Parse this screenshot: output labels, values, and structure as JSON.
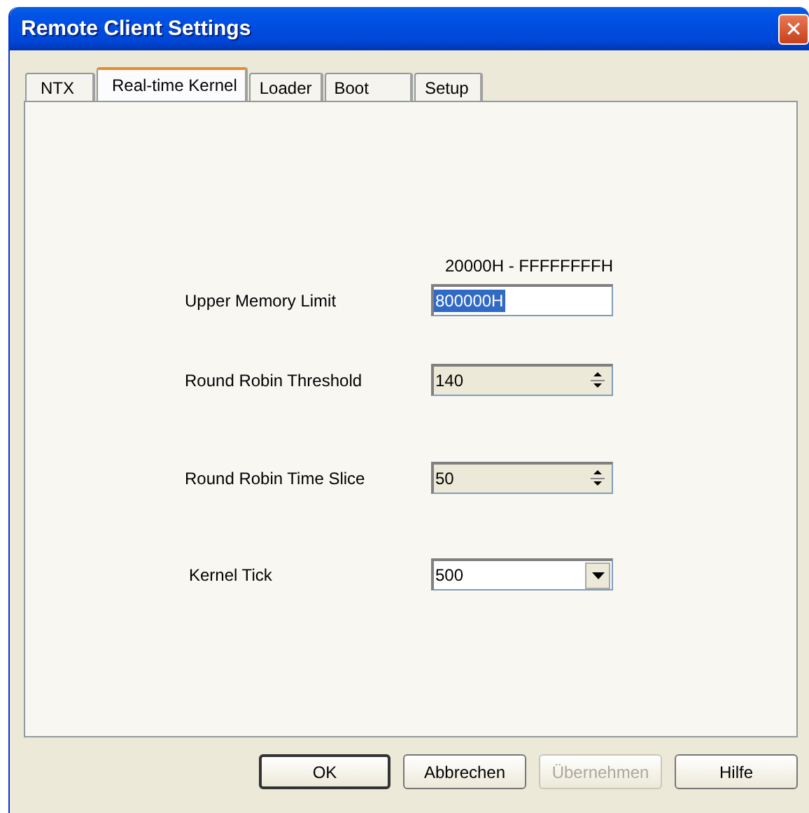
{
  "window": {
    "title": "Remote Client Settings",
    "close": "✕"
  },
  "tabs": [
    {
      "label": "NTX",
      "selected": false
    },
    {
      "label": "Real-time Kernel",
      "selected": true
    },
    {
      "label": "Loader",
      "selected": false
    },
    {
      "label": "Boot",
      "selected": false
    },
    {
      "label": "Setup",
      "selected": false
    }
  ],
  "fields": [
    {
      "kind": "text",
      "label": "Upper Memory Limit",
      "hint": "20000H - FFFFFFFFH",
      "value": "800000H",
      "text_selected": true
    },
    {
      "kind": "spin",
      "label": "Round Robin Threshold",
      "value": "140"
    },
    {
      "kind": "spin",
      "label": "Round Robin Time Slice",
      "value": "50"
    },
    {
      "kind": "combo",
      "label": "Kernel Tick",
      "value": "500"
    }
  ],
  "buttons": [
    {
      "label": "OK",
      "default": true,
      "disabled": false
    },
    {
      "label": "Abbrechen",
      "default": false,
      "disabled": false
    },
    {
      "label": "Übernehmen",
      "default": false,
      "disabled": true
    },
    {
      "label": "Hilfe",
      "default": false,
      "disabled": false
    }
  ]
}
